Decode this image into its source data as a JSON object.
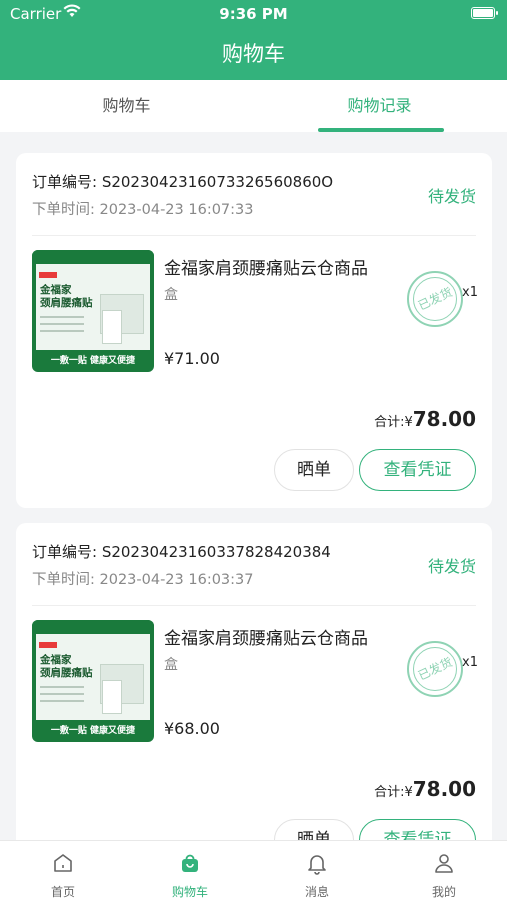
{
  "status_bar": {
    "carrier": "Carrier",
    "time": "9:36 PM"
  },
  "header": {
    "title": "购物车"
  },
  "tabs": [
    {
      "label": "购物车",
      "active": false
    },
    {
      "label": "购物记录",
      "active": true
    }
  ],
  "colors": {
    "accent": "#33b27c",
    "background": "#f3f4f6"
  },
  "orders": [
    {
      "order_no": "订单编号: S2023042316073326560860O",
      "order_time": "下单时间: 2023-04-23 16:07:33",
      "status": "待发货",
      "product": {
        "name": "金福家肩颈腰痛贴云仓商品",
        "unit": "盒",
        "price": "¥71.00",
        "stamp": "已发货",
        "qty": "x1",
        "thumb_title_1": "金福家",
        "thumb_title_2": "颈肩腰痛贴",
        "thumb_footer": "一敷一贴 健康又便捷"
      },
      "total_label": "合计:¥",
      "total_value": "78.00",
      "buttons": {
        "share": "晒单",
        "voucher": "查看凭证"
      }
    },
    {
      "order_no": "订单编号: S2023042316033782842038​4",
      "order_time": "下单时间: 2023-04-23 16:03:37",
      "status": "待发货",
      "product": {
        "name": "金福家肩颈腰痛贴云仓商品",
        "unit": "盒",
        "price": "¥68.00",
        "stamp": "已发货",
        "qty": "x1",
        "thumb_title_1": "金福家",
        "thumb_title_2": "颈肩腰痛贴",
        "thumb_footer": "一敷一贴 健康又便捷"
      },
      "total_label": "合计:¥",
      "total_value": "78.00",
      "buttons": {
        "share": "晒单",
        "voucher": "查看凭证"
      }
    }
  ],
  "bottom_nav": [
    {
      "label": "首页",
      "icon": "home-icon",
      "active": false
    },
    {
      "label": "购物车",
      "icon": "shopping-bag-icon",
      "active": true
    },
    {
      "label": "消息",
      "icon": "bell-icon",
      "active": false
    },
    {
      "label": "我的",
      "icon": "user-icon",
      "active": false
    }
  ]
}
